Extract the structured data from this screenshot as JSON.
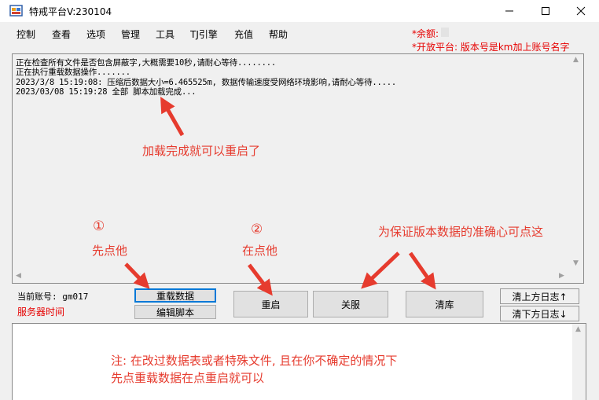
{
  "window": {
    "title": "特戒平台V:230104",
    "icons": {
      "app": "app-icon",
      "minimize": "minimize-icon",
      "maximize": "maximize-icon",
      "close": "close-icon"
    }
  },
  "menu": [
    "控制",
    "查看",
    "选项",
    "管理",
    "工具",
    "TJ引擎",
    "充值",
    "帮助"
  ],
  "info": {
    "balance": "*余额:",
    "platform_note": "*开放平台: 版本号是km加上账号名字"
  },
  "log": {
    "lines": [
      "正在检查所有文件是否包含屏蔽字,大概需要10秒,请耐心等待........",
      "正在执行重载数据操作.......",
      "2023/3/8 15:19:08: 压缩后数据大小=6.465525m, 数据传输速度受网络环境影响,请耐心等待.....",
      "2023/03/08 15:19:28 全部 脚本加载完成..."
    ]
  },
  "annotations": {
    "loaded": "加载完成就可以重启了",
    "step1_num": "①",
    "step1_text": "先点他",
    "step2_num": "②",
    "step2_text": "在点他",
    "accuracy": "为保证版本数据的准确心可点这"
  },
  "account": {
    "label": "当前账号: gm017",
    "server_time": "服务器时间"
  },
  "buttons": {
    "reload": "重载数据",
    "edit_script": "编辑脚本",
    "restart": "重启",
    "shutdown": "关服",
    "clear_db": "清库",
    "clear_upper_log": "清上方日志↑",
    "clear_lower_log": "清下方日志↓"
  },
  "notes": {
    "line1": "注: 在改过数据表或者特殊文件, 且在你不确定的情况下",
    "line2": "先点重载数据在点重启就可以"
  },
  "colors": {
    "annotation": "#e63b2e",
    "info_red": "#e60000",
    "focus_blue": "#0078d7"
  }
}
